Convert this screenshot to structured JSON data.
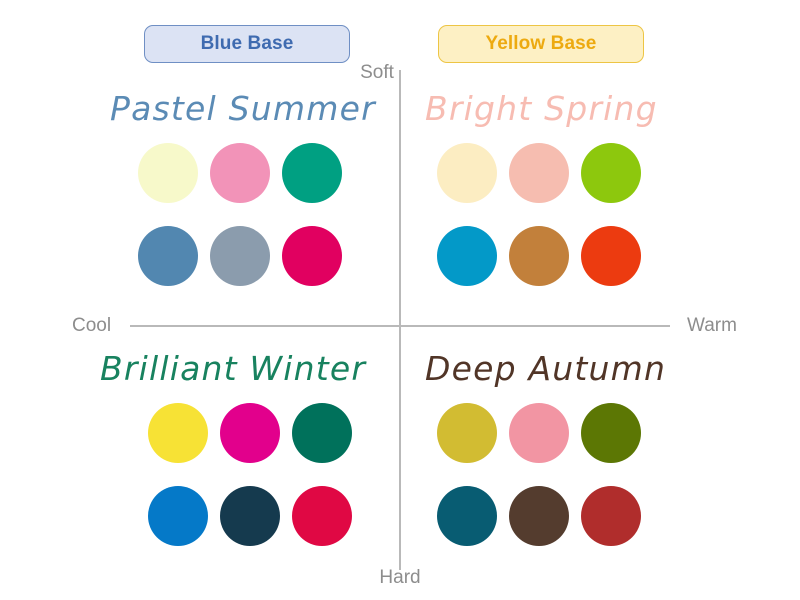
{
  "legend": {
    "blue_base": {
      "label": "Blue Base",
      "fill": "#dce3f4",
      "border": "#6f8fc4",
      "text": "#3f6bb0"
    },
    "yellow_base": {
      "label": "Yellow Base",
      "fill": "#fdf0c4",
      "border": "#edc544",
      "text": "#edaa10"
    }
  },
  "axes": {
    "top": "Soft",
    "bottom": "Hard",
    "left": "Cool",
    "right": "Warm",
    "line_color": "#b9b9b9",
    "label_color": "#8d8d8d"
  },
  "quadrants": [
    {
      "id": "pastel-summer",
      "title": "Pastel Summer",
      "title_color": "#5b8bb5",
      "base": "Blue Base",
      "position": "top-left",
      "swatches": [
        {
          "name": "pale-yellow",
          "hex": "#f7f9ca"
        },
        {
          "name": "pink",
          "hex": "#f293b8"
        },
        {
          "name": "teal-green",
          "hex": "#00a082"
        },
        {
          "name": "steel-blue",
          "hex": "#5287b0"
        },
        {
          "name": "slate-gray",
          "hex": "#8b9cad"
        },
        {
          "name": "deep-pink",
          "hex": "#e10060"
        }
      ]
    },
    {
      "id": "bright-spring",
      "title": "Bright Spring",
      "title_color": "#f7bcb2",
      "base": "Yellow Base",
      "position": "top-right",
      "swatches": [
        {
          "name": "cream",
          "hex": "#fcedc2"
        },
        {
          "name": "salmon-pink",
          "hex": "#f6bdb0"
        },
        {
          "name": "yellow-green",
          "hex": "#8dc80d"
        },
        {
          "name": "cyan-blue",
          "hex": "#0399c8"
        },
        {
          "name": "caramel",
          "hex": "#c2803b"
        },
        {
          "name": "orange-red",
          "hex": "#ec3b10"
        }
      ]
    },
    {
      "id": "brilliant-winter",
      "title": "Brilliant Winter",
      "title_color": "#18825f",
      "base": "Blue Base",
      "position": "bottom-left",
      "swatches": [
        {
          "name": "bright-yellow",
          "hex": "#f7e235"
        },
        {
          "name": "magenta",
          "hex": "#e2008c"
        },
        {
          "name": "dark-teal",
          "hex": "#00715b"
        },
        {
          "name": "bright-blue",
          "hex": "#0579c8"
        },
        {
          "name": "navy",
          "hex": "#153a4e"
        },
        {
          "name": "crimson",
          "hex": "#e00844"
        }
      ]
    },
    {
      "id": "deep-autumn",
      "title": "Deep Autumn",
      "title_color": "#513527",
      "base": "Yellow Base",
      "position": "bottom-right",
      "swatches": [
        {
          "name": "mustard",
          "hex": "#d2bc32"
        },
        {
          "name": "rose-pink",
          "hex": "#f295a3"
        },
        {
          "name": "olive-green",
          "hex": "#5c7704"
        },
        {
          "name": "deep-teal",
          "hex": "#085c72"
        },
        {
          "name": "dark-brown",
          "hex": "#543c2e"
        },
        {
          "name": "brick-red",
          "hex": "#b02d2c"
        }
      ]
    }
  ]
}
